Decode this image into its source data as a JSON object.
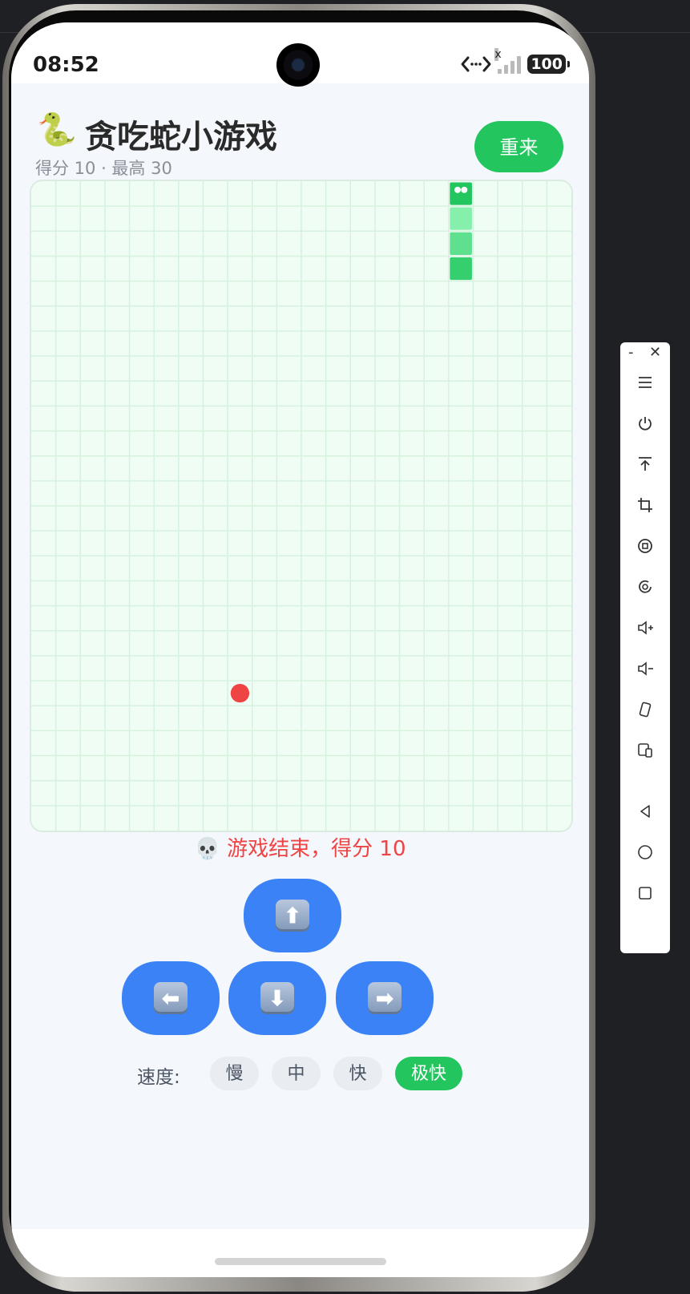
{
  "status_bar": {
    "time": "08:52",
    "battery": "100"
  },
  "app": {
    "title_emoji": "🐍",
    "title": "贪吃蛇小游戏",
    "subtitle": "得分 10 · 最高 30",
    "restart_label": "重来"
  },
  "board": {
    "cols": 22,
    "rows": 26,
    "snake": [
      {
        "col": 17,
        "row": 0,
        "part": "head"
      },
      {
        "col": 17,
        "row": 1,
        "part": "body"
      },
      {
        "col": 17,
        "row": 2,
        "part": "body"
      },
      {
        "col": 17,
        "row": 3,
        "part": "body"
      }
    ],
    "food": {
      "col": 8,
      "row": 20
    },
    "colors": {
      "background": "#f0fdf4",
      "grid": "#d6f2df",
      "head": "#22c55e",
      "body": [
        "#86efac",
        "#5ee08f",
        "#35cf6f"
      ],
      "food": "#ef4444"
    }
  },
  "game_over_text": "💀 游戏结束，得分 10",
  "controls": {
    "up": "⬆",
    "left": "⬅",
    "down": "⬇",
    "right": "➡"
  },
  "speed": {
    "label": "速度:",
    "options": [
      "慢",
      "中",
      "快",
      "极快"
    ],
    "selected": "极快"
  },
  "toolbar": {
    "minimize": "-",
    "close": "✕",
    "icons": [
      "menu-icon",
      "power-icon",
      "pin-top-icon",
      "crop-icon",
      "screen-record-icon",
      "rotate-icon",
      "volume-up-icon",
      "volume-down-icon",
      "shake-icon",
      "multi-device-icon",
      "back-icon",
      "home-icon",
      "recent-apps-icon"
    ]
  },
  "theme": {
    "primary_blue": "#3b82f6",
    "primary_green": "#22c55e",
    "danger_red": "#ef4444"
  }
}
